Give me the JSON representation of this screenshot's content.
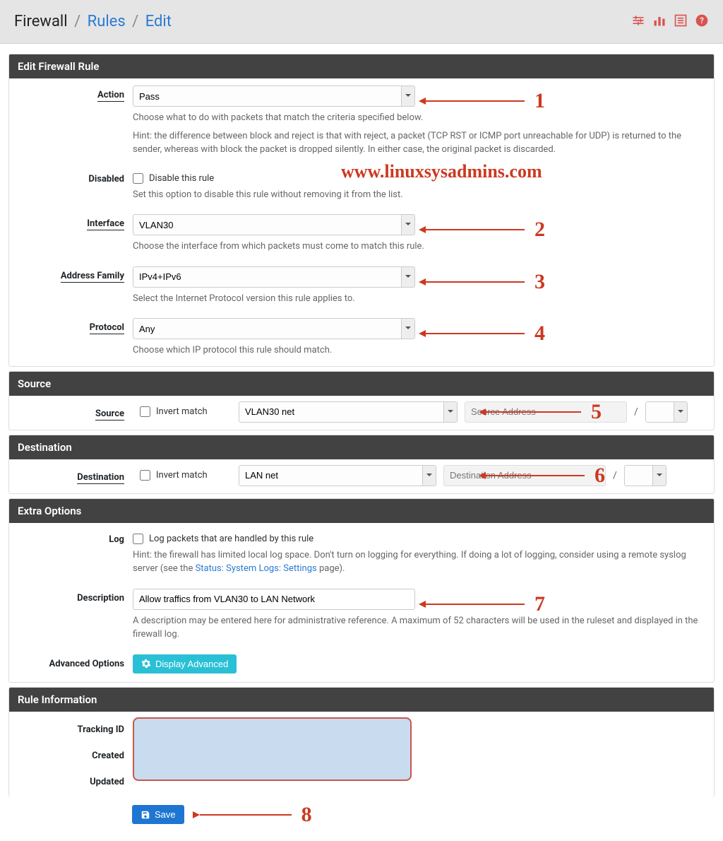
{
  "breadcrumb": {
    "root": "Firewall",
    "mid": "Rules",
    "leaf": "Edit"
  },
  "panels": {
    "edit": "Edit Firewall Rule",
    "source": "Source",
    "destination": "Destination",
    "extra": "Extra Options",
    "info": "Rule Information"
  },
  "labels": {
    "action": "Action",
    "disabled": "Disabled",
    "interface": "Interface",
    "address_family": "Address Family",
    "protocol": "Protocol",
    "source": "Source",
    "destination": "Destination",
    "log": "Log",
    "description": "Description",
    "advanced": "Advanced Options",
    "tracking_id": "Tracking ID",
    "created": "Created",
    "updated": "Updated"
  },
  "fields": {
    "action": {
      "value": "Pass",
      "help1": "Choose what to do with packets that match the criteria specified below.",
      "help2": "Hint: the difference between block and reject is that with reject, a packet (TCP RST or ICMP port unreachable for UDP) is returned to the sender, whereas with block the packet is dropped silently. In either case, the original packet is discarded."
    },
    "disabled": {
      "checkbox": "Disable this rule",
      "help": "Set this option to disable this rule without removing it from the list."
    },
    "interface": {
      "value": "VLAN30",
      "help": "Choose the interface from which packets must come to match this rule."
    },
    "address_family": {
      "value": "IPv4+IPv6",
      "help": "Select the Internet Protocol version this rule applies to."
    },
    "protocol": {
      "value": "Any",
      "help": "Choose which IP protocol this rule should match."
    },
    "invert": "Invert match",
    "source": {
      "value": "VLAN30 net",
      "addr_placeholder": "Source Address"
    },
    "destination": {
      "value": "LAN net",
      "addr_placeholder": "Destination Address"
    },
    "slash": "/",
    "log": {
      "checkbox": "Log packets that are handled by this rule",
      "help_pre": "Hint: the firewall has limited local log space. Don't turn on logging for everything. If doing a lot of logging, consider using a remote syslog server (see the ",
      "help_link": "Status: System Logs: Settings",
      "help_post": " page)."
    },
    "description": {
      "value": "Allow traffics from VLAN30 to LAN Network",
      "help": "A description may be entered here for administrative reference. A maximum of 52 characters will be used in the ruleset and displayed in the firewall log."
    },
    "advanced_btn": "Display Advanced",
    "save_btn": "Save"
  },
  "annotations": {
    "n1": "1",
    "n2": "2",
    "n3": "3",
    "n4": "4",
    "n5": "5",
    "n6": "6",
    "n7": "7",
    "n8": "8"
  },
  "watermark": "www.linuxsysadmins.com"
}
